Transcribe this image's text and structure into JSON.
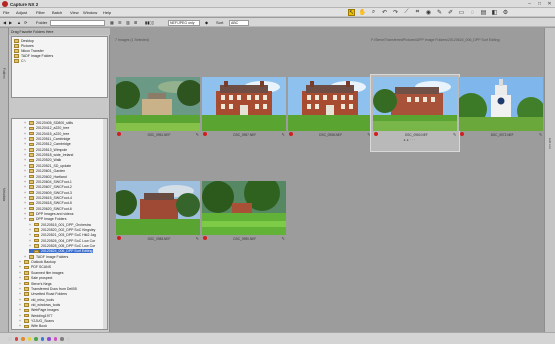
{
  "app": {
    "title": "Capture NX 2"
  },
  "window_controls": {
    "minimize": "–",
    "maximize": "□",
    "close": "✕"
  },
  "menu": [
    "File",
    "Adjust",
    "Filter",
    "Batch",
    "View",
    "Window",
    "Help"
  ],
  "toolbar": {
    "folder_label": "Folder",
    "sort_label": "Sort",
    "sort_value": "ABC",
    "filter_value": "NEF/JPEG only"
  },
  "sidebar": {
    "header": "Drag Favorite Folders Here",
    "favorites": [
      "Desktop",
      "Pictures",
      "Nikon Transfer",
      "TADF Image Folders",
      "C:\\"
    ],
    "tree": [
      {
        "label": "20120405_SD800_stills",
        "depth": 2
      },
      {
        "label": "20120412_a220_tree",
        "depth": 2
      },
      {
        "label": "20120415_a220_tree",
        "depth": 2
      },
      {
        "label": "20120511_Cambridge",
        "depth": 2
      },
      {
        "label": "20120512_Cambridge",
        "depth": 2
      },
      {
        "label": "20120513_Wimpole",
        "depth": 2
      },
      {
        "label": "20120518_wide_Ireland",
        "depth": 2
      },
      {
        "label": "20120520_Walk",
        "depth": 2
      },
      {
        "label": "20120521_SD_update",
        "depth": 2
      },
      {
        "label": "20120601_Garden",
        "depth": 2
      },
      {
        "label": "20120602_Hartland",
        "depth": 2
      },
      {
        "label": "20120604_SWCFoot-1",
        "depth": 2
      },
      {
        "label": "20120607_SWCFoot-2",
        "depth": 2
      },
      {
        "label": "20120609_SWCFoot-3",
        "depth": 2
      },
      {
        "label": "20120615_SWCFoot-4",
        "depth": 2
      },
      {
        "label": "20120618_SWCFoot-5",
        "depth": 2
      },
      {
        "label": "20120620_SWCFoot-6",
        "depth": 2
      },
      {
        "label": "DPP Images and videos",
        "depth": 2
      },
      {
        "label": "DPP Image Folders",
        "depth": 2
      },
      {
        "label": "20120515_001_DPP_Orchestra",
        "depth": 3
      },
      {
        "label": "20120520_002_DPP SoC Kingsley",
        "depth": 3
      },
      {
        "label": "20120521_003_DPP SoC Hkt2 Jag",
        "depth": 3
      },
      {
        "label": "20120526_004_DPP SoC Low Cor",
        "depth": 3
      },
      {
        "label": "20120528_005_DPP SoC Low Cor",
        "depth": 3
      },
      {
        "label": "20120624_006_DPP Surf Editing",
        "depth": 3,
        "selected": true
      },
      {
        "label": "TADF Image Folders",
        "depth": 2
      },
      {
        "label": "Outlook Backup",
        "depth": 1
      },
      {
        "label": "PDF SCANS",
        "depth": 1
      },
      {
        "label": "Scanned film images",
        "depth": 1
      },
      {
        "label": "Sale prospect",
        "depth": 1
      },
      {
        "label": "Steve's Negs",
        "depth": 1
      },
      {
        "label": "Transferred Docs from Dell05",
        "depth": 1
      },
      {
        "label": "Unvetted Road Folders",
        "depth": 1
      },
      {
        "label": "vid_misc_tools",
        "depth": 1
      },
      {
        "label": "vid_windows_tools",
        "depth": 1
      },
      {
        "label": "WebPage Images",
        "depth": 1
      },
      {
        "label": "Wedding1977",
        "depth": 1
      },
      {
        "label": "Y2JUG_Scans",
        "depth": 1
      },
      {
        "label": "Wife Book",
        "depth": 1
      }
    ]
  },
  "browser": {
    "count_text": "7 Images (1 Selected)",
    "path_text": "F:\\Steve\\TransferredPictures\\DPP Image Folders\\20120624_006_DPP Surf Editing",
    "thumbnails": [
      {
        "caption": "DSC_0951.NEF",
        "scene": "house-trees",
        "selected": false
      },
      {
        "caption": "DSC_0957.NEF",
        "scene": "house-front",
        "selected": false
      },
      {
        "caption": "DSC_0958.NEF",
        "scene": "house-front",
        "selected": false
      },
      {
        "caption": "DSC_0960.NEF",
        "scene": "house-tree",
        "selected": true
      },
      {
        "caption": "DSC_0972.NEF",
        "scene": "tower",
        "selected": false
      },
      {
        "caption": "DSC_0983.NEF",
        "scene": "house-side",
        "selected": false
      },
      {
        "caption": "DSC_0990.NEF",
        "scene": "lawn-trees",
        "selected": false
      }
    ]
  },
  "status": {
    "label_colors": [
      "#cfcfcf",
      "#d24343",
      "#e08b2c",
      "#e6d13d",
      "#49a64a",
      "#3a7ad6",
      "#8a4ad6",
      "#d04fbf",
      "#7f7f7f",
      "#cfcfcf"
    ]
  },
  "colors": {
    "accent": "#3a6fd0",
    "badge": "#d21e1e"
  }
}
